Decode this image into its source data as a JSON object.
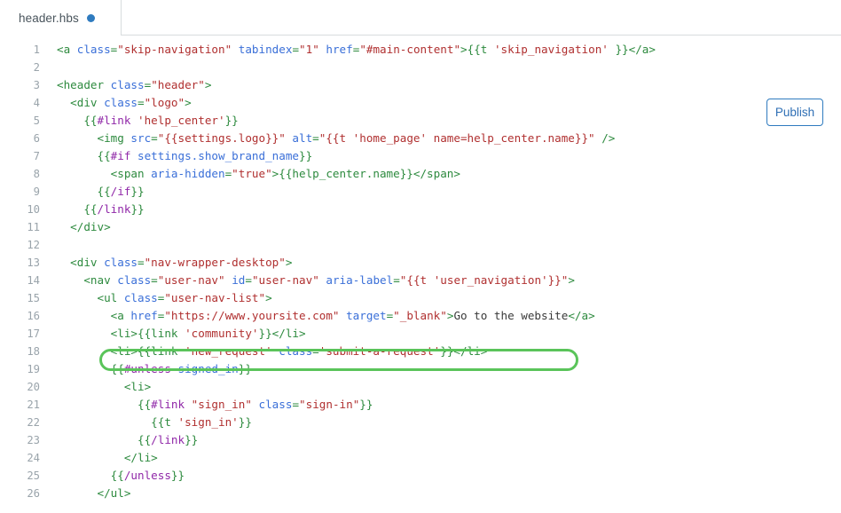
{
  "tab": {
    "label": "header.hbs",
    "unsaved_indicator": "unsaved-dot",
    "dot_color": "#2f7bbf"
  },
  "toolbar": {
    "publish_label": "Publish",
    "publish_color": "#2f7bbf"
  },
  "highlight": {
    "color": "#5ac45a",
    "target_line": 16,
    "shape": "rounded-rectangle-outline"
  },
  "editor": {
    "language": "handlebars",
    "first_visible_line": 1,
    "last_visible_line": 26,
    "syntax_colors": {
      "tag": "#2d8a3e",
      "attribute": "#3a6fd8",
      "value": "#b03030",
      "block_helper": "#9028a8",
      "text": "#3a3a3a",
      "line_number": "#9aa4ab"
    },
    "lines": [
      {
        "n": "1",
        "tokens": [
          {
            "t": "tag",
            "s": "<a "
          },
          {
            "t": "attr",
            "s": "class"
          },
          {
            "t": "tag",
            "s": "="
          },
          {
            "t": "val",
            "s": "\"skip-navigation\""
          },
          {
            "t": "tag",
            "s": " "
          },
          {
            "t": "attr",
            "s": "tabindex"
          },
          {
            "t": "tag",
            "s": "="
          },
          {
            "t": "val",
            "s": "\"1\""
          },
          {
            "t": "tag",
            "s": " "
          },
          {
            "t": "attr",
            "s": "href"
          },
          {
            "t": "tag",
            "s": "="
          },
          {
            "t": "val",
            "s": "\"#main-content\""
          },
          {
            "t": "tag",
            "s": ">{{"
          },
          {
            "t": "tag",
            "s": "t "
          },
          {
            "t": "val",
            "s": "'skip_navigation'"
          },
          {
            "t": "tag",
            "s": " }}</a>"
          }
        ]
      },
      {
        "n": "2",
        "tokens": []
      },
      {
        "n": "3",
        "tokens": [
          {
            "t": "tag",
            "s": "<header "
          },
          {
            "t": "attr",
            "s": "class"
          },
          {
            "t": "tag",
            "s": "="
          },
          {
            "t": "val",
            "s": "\"header\""
          },
          {
            "t": "tag",
            "s": ">"
          }
        ]
      },
      {
        "n": "4",
        "tokens": [
          {
            "t": "tag",
            "s": "  <div "
          },
          {
            "t": "attr",
            "s": "class"
          },
          {
            "t": "tag",
            "s": "="
          },
          {
            "t": "val",
            "s": "\"logo\""
          },
          {
            "t": "tag",
            "s": ">"
          }
        ]
      },
      {
        "n": "5",
        "tokens": [
          {
            "t": "tag",
            "s": "    "
          },
          {
            "t": "tag",
            "s": "{{"
          },
          {
            "t": "hb",
            "s": "#link "
          },
          {
            "t": "val",
            "s": "'help_center'"
          },
          {
            "t": "tag",
            "s": "}}"
          }
        ]
      },
      {
        "n": "6",
        "tokens": [
          {
            "t": "tag",
            "s": "      <img "
          },
          {
            "t": "attr",
            "s": "src"
          },
          {
            "t": "tag",
            "s": "="
          },
          {
            "t": "val",
            "s": "\"{{settings.logo}}\""
          },
          {
            "t": "tag",
            "s": " "
          },
          {
            "t": "attr",
            "s": "alt"
          },
          {
            "t": "tag",
            "s": "="
          },
          {
            "t": "val",
            "s": "\"{{t 'home_page' name=help_center.name}}\""
          },
          {
            "t": "tag",
            "s": " />"
          }
        ]
      },
      {
        "n": "7",
        "tokens": [
          {
            "t": "tag",
            "s": "      "
          },
          {
            "t": "tag",
            "s": "{{"
          },
          {
            "t": "hb",
            "s": "#if "
          },
          {
            "t": "attr",
            "s": "settings.show_brand_name"
          },
          {
            "t": "tag",
            "s": "}}"
          }
        ]
      },
      {
        "n": "8",
        "tokens": [
          {
            "t": "tag",
            "s": "        <span "
          },
          {
            "t": "attr",
            "s": "aria-hidden"
          },
          {
            "t": "tag",
            "s": "="
          },
          {
            "t": "val",
            "s": "\"true\""
          },
          {
            "t": "tag",
            "s": ">{{help_center.name}}</span>"
          }
        ]
      },
      {
        "n": "9",
        "tokens": [
          {
            "t": "tag",
            "s": "      "
          },
          {
            "t": "tag",
            "s": "{{"
          },
          {
            "t": "hb",
            "s": "/if"
          },
          {
            "t": "tag",
            "s": "}}"
          }
        ]
      },
      {
        "n": "10",
        "tokens": [
          {
            "t": "tag",
            "s": "    "
          },
          {
            "t": "tag",
            "s": "{{"
          },
          {
            "t": "hb",
            "s": "/link"
          },
          {
            "t": "tag",
            "s": "}}"
          }
        ]
      },
      {
        "n": "11",
        "tokens": [
          {
            "t": "tag",
            "s": "  </div>"
          }
        ]
      },
      {
        "n": "12",
        "tokens": []
      },
      {
        "n": "13",
        "tokens": [
          {
            "t": "tag",
            "s": "  <div "
          },
          {
            "t": "attr",
            "s": "class"
          },
          {
            "t": "tag",
            "s": "="
          },
          {
            "t": "val",
            "s": "\"nav-wrapper-desktop\""
          },
          {
            "t": "tag",
            "s": ">"
          }
        ]
      },
      {
        "n": "14",
        "tokens": [
          {
            "t": "tag",
            "s": "    <nav "
          },
          {
            "t": "attr",
            "s": "class"
          },
          {
            "t": "tag",
            "s": "="
          },
          {
            "t": "val",
            "s": "\"user-nav\""
          },
          {
            "t": "tag",
            "s": " "
          },
          {
            "t": "attr",
            "s": "id"
          },
          {
            "t": "tag",
            "s": "="
          },
          {
            "t": "val",
            "s": "\"user-nav\""
          },
          {
            "t": "tag",
            "s": " "
          },
          {
            "t": "attr",
            "s": "aria-label"
          },
          {
            "t": "tag",
            "s": "="
          },
          {
            "t": "val",
            "s": "\"{{t 'user_navigation'}}\""
          },
          {
            "t": "tag",
            "s": ">"
          }
        ]
      },
      {
        "n": "15",
        "tokens": [
          {
            "t": "tag",
            "s": "      <ul "
          },
          {
            "t": "attr",
            "s": "class"
          },
          {
            "t": "tag",
            "s": "="
          },
          {
            "t": "val",
            "s": "\"user-nav-list\""
          },
          {
            "t": "tag",
            "s": ">"
          }
        ]
      },
      {
        "n": "16",
        "tokens": [
          {
            "t": "tag",
            "s": "        <a "
          },
          {
            "t": "attr",
            "s": "href"
          },
          {
            "t": "tag",
            "s": "="
          },
          {
            "t": "val",
            "s": "\"https://www.yoursite.com\""
          },
          {
            "t": "tag",
            "s": " "
          },
          {
            "t": "attr",
            "s": "target"
          },
          {
            "t": "tag",
            "s": "="
          },
          {
            "t": "val",
            "s": "\"_blank\""
          },
          {
            "t": "tag",
            "s": ">"
          },
          {
            "t": "txt",
            "s": "Go to the website"
          },
          {
            "t": "tag",
            "s": "</a>"
          }
        ]
      },
      {
        "n": "17",
        "tokens": [
          {
            "t": "tag",
            "s": "        <li>{{"
          },
          {
            "t": "tag",
            "s": "link "
          },
          {
            "t": "val",
            "s": "'community'"
          },
          {
            "t": "tag",
            "s": "}}</li>"
          }
        ]
      },
      {
        "n": "18",
        "tokens": [
          {
            "t": "tag",
            "s": "        <li>{{"
          },
          {
            "t": "tag",
            "s": "link "
          },
          {
            "t": "val",
            "s": "'new_request'"
          },
          {
            "t": "tag",
            "s": " "
          },
          {
            "t": "attr",
            "s": "class"
          },
          {
            "t": "tag",
            "s": "="
          },
          {
            "t": "val",
            "s": "'submit-a-request'"
          },
          {
            "t": "tag",
            "s": "}}</li>"
          }
        ]
      },
      {
        "n": "19",
        "tokens": [
          {
            "t": "tag",
            "s": "        "
          },
          {
            "t": "tag",
            "s": "{{"
          },
          {
            "t": "hb",
            "s": "#unless "
          },
          {
            "t": "attr",
            "s": "signed_in"
          },
          {
            "t": "tag",
            "s": "}}"
          }
        ]
      },
      {
        "n": "20",
        "tokens": [
          {
            "t": "tag",
            "s": "          <li>"
          }
        ]
      },
      {
        "n": "21",
        "tokens": [
          {
            "t": "tag",
            "s": "            "
          },
          {
            "t": "tag",
            "s": "{{"
          },
          {
            "t": "hb",
            "s": "#link "
          },
          {
            "t": "val",
            "s": "\"sign_in\""
          },
          {
            "t": "tag",
            "s": " "
          },
          {
            "t": "attr",
            "s": "class"
          },
          {
            "t": "tag",
            "s": "="
          },
          {
            "t": "val",
            "s": "\"sign-in\""
          },
          {
            "t": "tag",
            "s": "}}"
          }
        ]
      },
      {
        "n": "22",
        "tokens": [
          {
            "t": "tag",
            "s": "              {{"
          },
          {
            "t": "tag",
            "s": "t "
          },
          {
            "t": "val",
            "s": "'sign_in'"
          },
          {
            "t": "tag",
            "s": "}}"
          }
        ]
      },
      {
        "n": "23",
        "tokens": [
          {
            "t": "tag",
            "s": "            "
          },
          {
            "t": "tag",
            "s": "{{"
          },
          {
            "t": "hb",
            "s": "/link"
          },
          {
            "t": "tag",
            "s": "}}"
          }
        ]
      },
      {
        "n": "24",
        "tokens": [
          {
            "t": "tag",
            "s": "          </li>"
          }
        ]
      },
      {
        "n": "25",
        "tokens": [
          {
            "t": "tag",
            "s": "        "
          },
          {
            "t": "tag",
            "s": "{{"
          },
          {
            "t": "hb",
            "s": "/unless"
          },
          {
            "t": "tag",
            "s": "}}"
          }
        ]
      },
      {
        "n": "26",
        "tokens": [
          {
            "t": "tag",
            "s": "      </ul>"
          }
        ]
      }
    ]
  }
}
